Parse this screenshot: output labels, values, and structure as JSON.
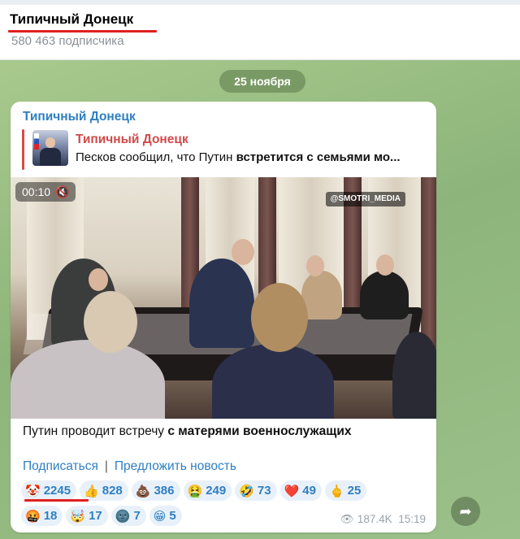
{
  "header": {
    "channel_title": "Типичный Донецк",
    "subscribers": "580 463 подписчика"
  },
  "chat": {
    "date_pill": "25 ноября",
    "message": {
      "sender": "Типичный Донецк",
      "reply": {
        "name": "Типичный Донецк",
        "text_plain": "Песков сообщил, что Путин ",
        "text_bold": "встретится с семьями мо..."
      },
      "video": {
        "duration": "00:10",
        "mute_icon": "mute-icon",
        "watermark": "@SMOTRI_MEDIA"
      },
      "caption_plain": "Путин проводит встречу ",
      "caption_bold": "с матерями военнослужащих",
      "links": {
        "subscribe": "Подписаться",
        "separator": "|",
        "suggest": "Предложить новость"
      },
      "reactions": [
        [
          {
            "emoji": "🤡",
            "icon": "clown-icon",
            "count": "2245"
          },
          {
            "emoji": "👍",
            "icon": "thumbs-up-icon",
            "count": "828"
          },
          {
            "emoji": "💩",
            "icon": "poop-icon",
            "count": "386"
          },
          {
            "emoji": "🤮",
            "icon": "vomit-icon",
            "count": "249"
          },
          {
            "emoji": "🤣",
            "icon": "rofl-icon",
            "count": "73"
          },
          {
            "emoji": "❤️",
            "icon": "heart-icon",
            "count": "49"
          },
          {
            "emoji": "🖕",
            "icon": "middle-finger-icon",
            "count": "25"
          }
        ],
        [
          {
            "emoji": "🤬",
            "icon": "cursing-icon",
            "count": "18"
          },
          {
            "emoji": "🤯",
            "icon": "mind-blown-icon",
            "count": "17"
          },
          {
            "emoji": "🌚",
            "icon": "dark-moon-icon",
            "count": "7"
          },
          {
            "emoji": "😁",
            "icon": "grin-icon",
            "count": "5"
          }
        ]
      ],
      "views": "187.4K",
      "time": "15:19"
    },
    "share_icon": "share-arrow-icon"
  }
}
